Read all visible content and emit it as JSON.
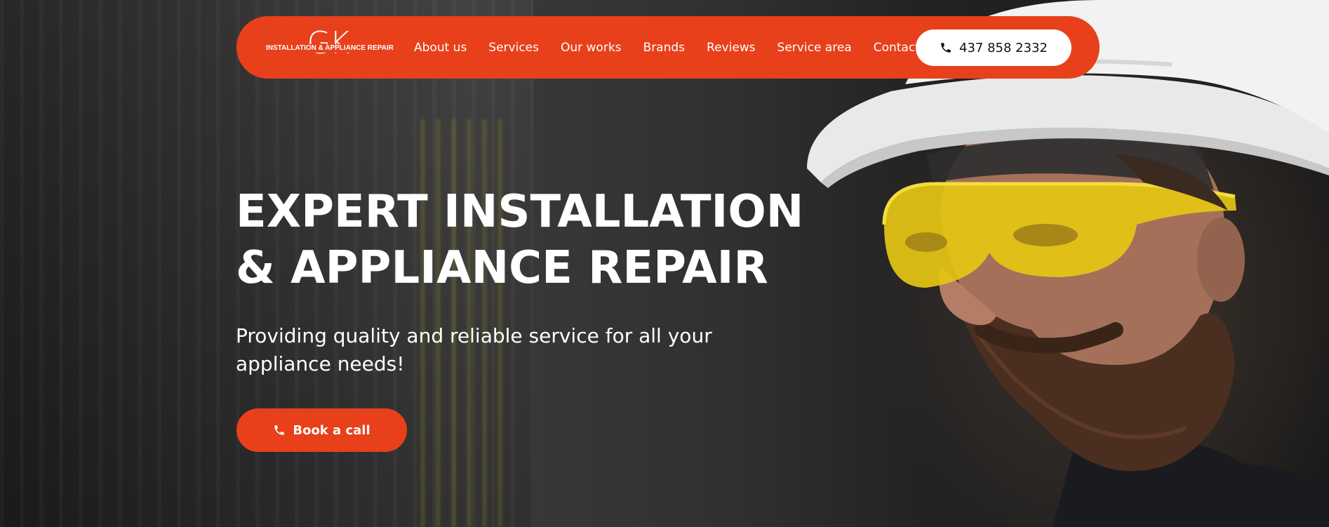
{
  "navbar": {
    "logo": {
      "mark": "GK",
      "tagline": "INSTALLATION & APPLIANCE REPAIR"
    },
    "links": [
      {
        "label": "About us"
      },
      {
        "label": "Services"
      },
      {
        "label": "Our works"
      },
      {
        "label": "Brands"
      },
      {
        "label": "Reviews"
      },
      {
        "label": "Service area"
      },
      {
        "label": "Contacts"
      }
    ],
    "phone": {
      "icon": "phone-icon",
      "label": "437 858 2332"
    }
  },
  "hero": {
    "title_lines": [
      "EXPERT INSTALLATION",
      "& APPLIANCE REPAIR"
    ],
    "subtitle_lines": [
      "Providing quality and reliable service for all your",
      "appliance needs!"
    ],
    "cta": {
      "icon": "phone-icon",
      "label": "Book a call"
    }
  },
  "colors": {
    "accent": "#e8401b",
    "text_light": "#ffffff",
    "background_dark": "#2b2b2b"
  }
}
